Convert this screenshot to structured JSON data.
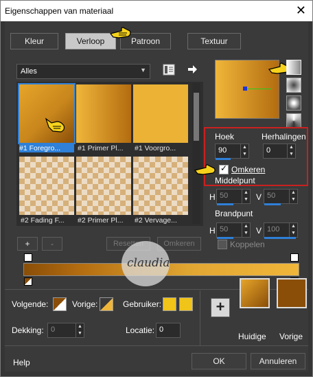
{
  "window": {
    "title": "Eigenschappen van materiaal",
    "close_glyph": "✕"
  },
  "tabs": [
    {
      "label": "Kleur"
    },
    {
      "label": "Verloop"
    },
    {
      "label": "Patroon"
    },
    {
      "label": "Textuur"
    }
  ],
  "gradient_list": {
    "category": "Alles",
    "items": [
      {
        "label": "#1 Foregro..."
      },
      {
        "label": "#1 Primer Pl..."
      },
      {
        "label": "#1 Voorgro..."
      },
      {
        "label": "#2 Fading F..."
      },
      {
        "label": "#2 Primer Pl..."
      },
      {
        "label": "#2 Vervage..."
      }
    ]
  },
  "angle": {
    "label": "Hoek",
    "value": "90"
  },
  "repeats": {
    "label": "Herhalingen",
    "value": "0"
  },
  "invert": {
    "label": "Omkeren",
    "checked": true
  },
  "center_point": {
    "label": "Middelpunt",
    "h_label": "H",
    "h_value": "50",
    "v_label": "V",
    "v_value": "50"
  },
  "focal_point": {
    "label": "Brandpunt",
    "h_label": "H",
    "h_value": "50",
    "v_label": "V",
    "v_value": "100"
  },
  "link": {
    "label": "Koppelen"
  },
  "stop_buttons": {
    "add": "+",
    "remove": "-",
    "left_disabled": "Resetten",
    "right_disabled": "Omkeren"
  },
  "bottom": {
    "next_label": "Volgende:",
    "prev_label": "Vorige:",
    "user_label": "Gebruiker:",
    "opacity_label": "Dekking:",
    "opacity_value": "0",
    "location_label": "Locatie:",
    "location_value": "0"
  },
  "swatches": {
    "current_label": "Huidige",
    "previous_label": "Vorige",
    "plus": "+"
  },
  "footer": {
    "help": "Help",
    "ok": "OK",
    "cancel": "Annuleren"
  },
  "watermark": {
    "text": "claudia"
  },
  "colors": {
    "accent_blue": "#2e80d8",
    "highlight_red": "#cc1f1f",
    "gold": "#e8b23a",
    "brown": "#8a4e08"
  }
}
